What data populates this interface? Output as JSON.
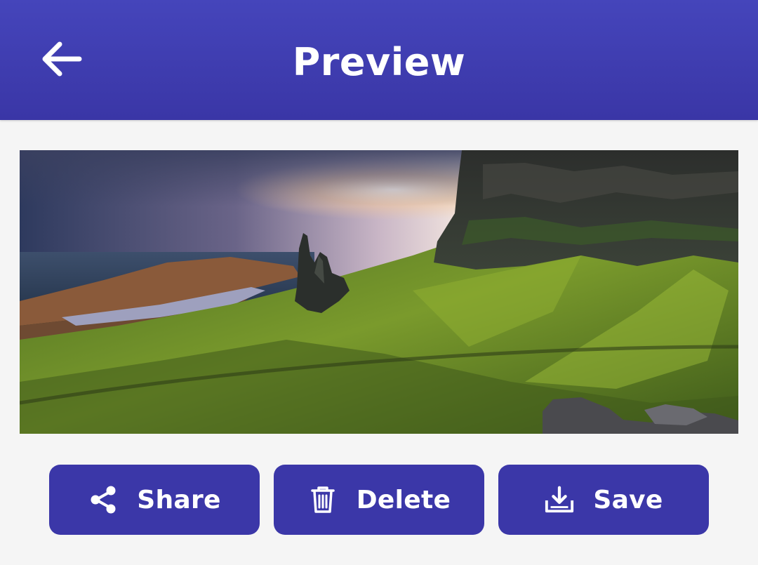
{
  "header": {
    "title": "Preview",
    "back_icon": "arrow-left-icon",
    "background": "#3b37a8"
  },
  "preview": {
    "image": "landscape-photo"
  },
  "actions": [
    {
      "label": "Share",
      "icon": "share-icon"
    },
    {
      "label": "Delete",
      "icon": "trash-icon"
    },
    {
      "label": "Save",
      "icon": "download-icon"
    }
  ],
  "colors": {
    "accent": "#3b37a8",
    "background": "#f5f5f5",
    "text_on_accent": "#ffffff"
  }
}
